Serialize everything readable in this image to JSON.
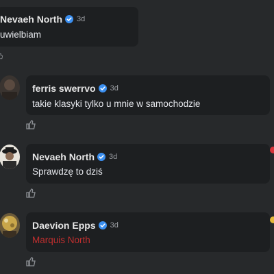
{
  "comments": [
    {
      "author": "Nevaeh North",
      "time": "3d",
      "text": "uwielbiam"
    },
    {
      "author": "ferris swerrvo",
      "time": "3d",
      "text": "takie klasyki tylko u mnie w samochodzie"
    },
    {
      "author": "Nevaeh North",
      "time": "3d",
      "text": "Sprawdzę to dziś"
    },
    {
      "author": "Daevion Epps",
      "time": "3d",
      "text": "Marquis North"
    }
  ],
  "icons": {
    "verified": "verified-badge-icon",
    "like": "thumbs-up-icon"
  },
  "colors": {
    "background": "#27292b",
    "bubble": "#1d1f21",
    "verified": "#3b8ff0",
    "mention": "#c02f2f"
  }
}
